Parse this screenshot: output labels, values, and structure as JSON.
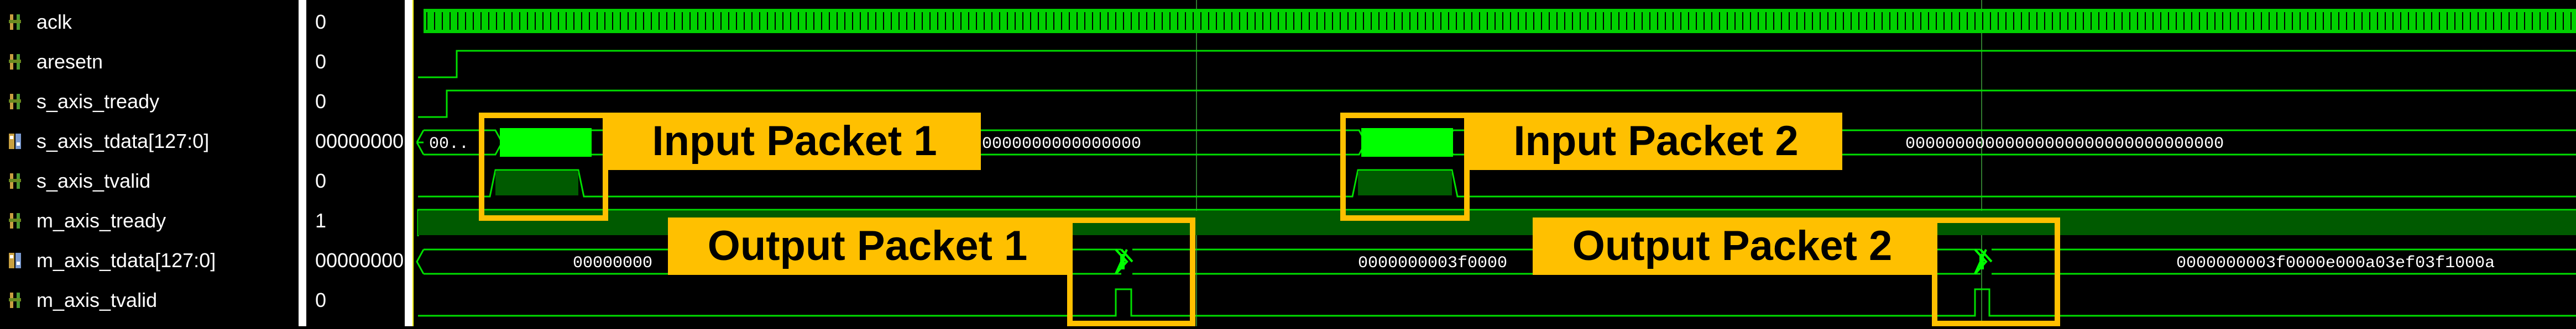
{
  "signals": [
    {
      "name": "aclk",
      "value": "0",
      "icon": "logic-signal-icon"
    },
    {
      "name": "aresetn",
      "value": "0",
      "icon": "logic-signal-icon"
    },
    {
      "name": "s_axis_tready",
      "value": "0",
      "icon": "logic-signal-icon"
    },
    {
      "name": "s_axis_tdata[127:0]",
      "value": "00000000",
      "icon": "bus-signal-icon"
    },
    {
      "name": "s_axis_tvalid",
      "value": "0",
      "icon": "logic-signal-icon"
    },
    {
      "name": "m_axis_tready",
      "value": "1",
      "icon": "logic-signal-icon"
    },
    {
      "name": "m_axis_tdata[127:0]",
      "value": "00000000",
      "icon": "bus-signal-icon"
    },
    {
      "name": "m_axis_tvalid",
      "value": "0",
      "icon": "logic-signal-icon"
    }
  ],
  "bus_labels": {
    "s_tdata_start": "00..",
    "s_tdata_mid": "0000000000000000",
    "s_tdata_end": "00000000000000000000000000000000",
    "m_tdata_start": "00000000",
    "m_tdata_mid": "0000000003f0000",
    "m_tdata_end": "0000000003f0000e000a03ef03f1000a"
  },
  "callouts": {
    "input1": "Input Packet 1",
    "input2": "Input Packet 2",
    "output1": "Output Packet 1",
    "output2": "Output Packet 2"
  },
  "colors": {
    "waveform": "#00e000",
    "highlight": "#ffc000",
    "packet_fill": "#00ff00",
    "grid": "#2f7a2f"
  }
}
